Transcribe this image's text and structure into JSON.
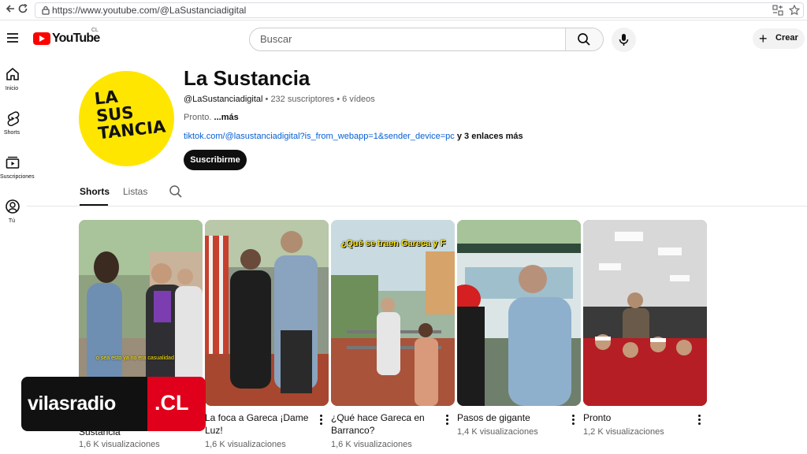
{
  "browser": {
    "url": "https://www.youtube.com/@LaSustanciadigital",
    "icons": [
      "back-icon",
      "reload-icon",
      "lock-icon",
      "translate-icon",
      "favorite-icon"
    ]
  },
  "masthead": {
    "logo_text": "YouTube",
    "country_code": "CL",
    "search_placeholder": "Buscar",
    "create_label": "Crear"
  },
  "guide": {
    "items": [
      {
        "label": "Inicio",
        "icon": "home-icon"
      },
      {
        "label": "Shorts",
        "icon": "shorts-icon"
      },
      {
        "label": "Suscripciones",
        "icon": "subscriptions-icon"
      },
      {
        "label": "Tú",
        "icon": "you-icon"
      }
    ]
  },
  "channel": {
    "name": "La Sustancia",
    "avatar_text": "LA SUS TANCIA",
    "handle": "@LaSustanciadigital",
    "subscribers": "232 suscriptores",
    "videos": "6 vídeos",
    "separator": "•",
    "description": "Pronto.",
    "more_label": "...más",
    "link": "tiktok.com/@lasustanciadigital?is_from_webapp=1&sender_device=pc",
    "more_links": "y 3 enlaces más",
    "subscribe_label": "Suscribirme"
  },
  "tabs": {
    "items": [
      "Shorts",
      "Listas"
    ],
    "active": "Shorts"
  },
  "shorts": [
    {
      "title": "Sustancia",
      "views": "1,6 K visualizaciones",
      "caption": "o sea esto ya no era casualidad",
      "palette": [
        "#6f8a63",
        "#b7a98f"
      ]
    },
    {
      "title": "La foca a Gareca ¡Dame Luz!",
      "views": "1,6 K visualizaciones",
      "caption": "",
      "palette": [
        "#7d7f7a",
        "#a9402e"
      ]
    },
    {
      "title": "¿Qué hace Gareca en Barranco?",
      "views": "1,6 K visualizaciones",
      "caption": "¿Qué se traen Gareca y F",
      "palette": [
        "#5f8f5a",
        "#a9533b"
      ]
    },
    {
      "title": "Pasos de gigante",
      "views": "1,4 K visualizaciones",
      "caption": "",
      "palette": [
        "#5b6a5c",
        "#9ab7cc"
      ]
    },
    {
      "title": "Pronto",
      "views": "1,2 K visualizaciones",
      "caption": "",
      "palette": [
        "#2d2d2d",
        "#c7252b"
      ]
    }
  ],
  "watermark": {
    "brand": "vilasradio",
    "domain": ".CL"
  },
  "colors": {
    "youtube_red": "#ff0000",
    "avatar_yellow": "#ffe600",
    "link_blue": "#065fd4",
    "watermark_red": "#e0001b"
  }
}
